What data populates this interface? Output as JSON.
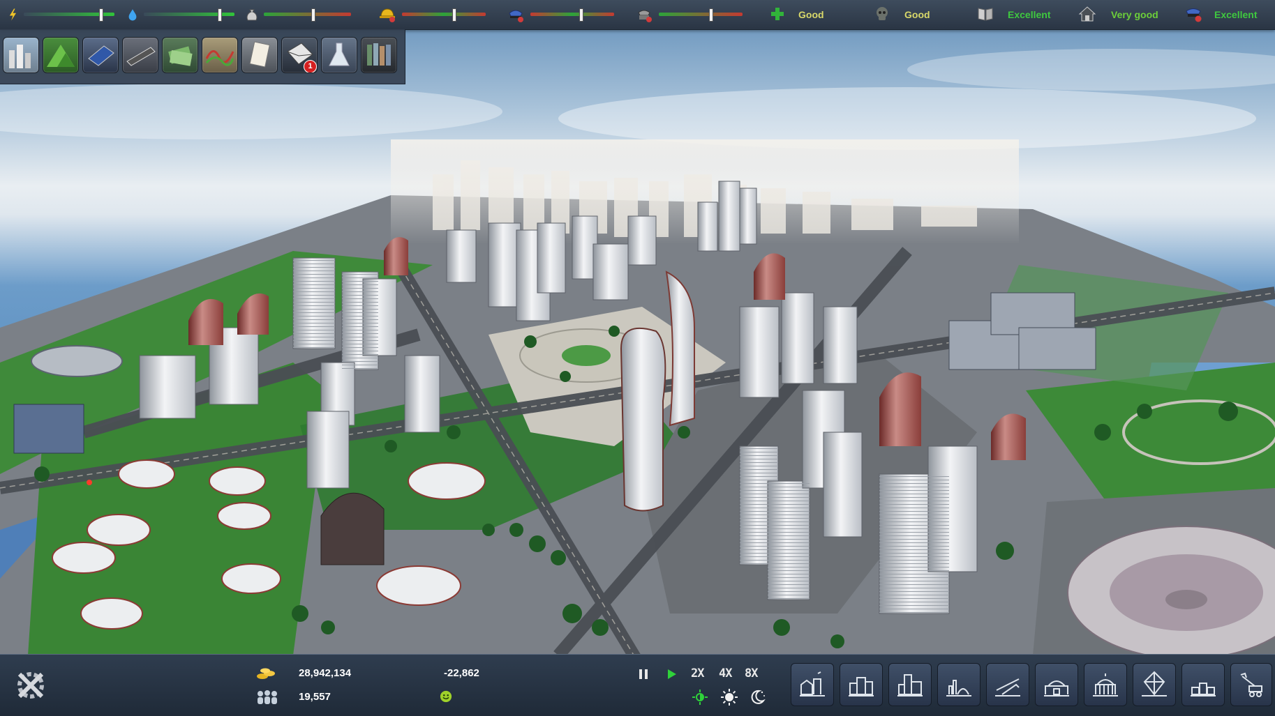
{
  "top_bar": {
    "meters": [
      {
        "name": "power",
        "icon": "lightning-icon",
        "level": 0.72
      },
      {
        "name": "water",
        "icon": "water-drop-icon",
        "level": 0.62
      },
      {
        "name": "waste",
        "icon": "trash-bag-icon",
        "level": 0.55
      },
      {
        "name": "fire",
        "icon": "firefighter-helmet-icon",
        "level": 0.55
      },
      {
        "name": "police",
        "icon": "police-cap-icon",
        "level": 0.55
      },
      {
        "name": "crime",
        "icon": "criminal-mask-icon",
        "level": 0.55
      }
    ],
    "ratings": [
      {
        "icon": "health-cross-icon",
        "label": "Good",
        "color": "#d9d96a"
      },
      {
        "icon": "education-skull-icon",
        "label": "Good",
        "color": "#d9d96a"
      },
      {
        "icon": "library-book-icon",
        "label": "Excellent",
        "color": "#3fc93f"
      },
      {
        "icon": "housing-icon",
        "label": "Very good",
        "color": "#6ccf3a"
      },
      {
        "icon": "security-icon",
        "label": "Excellent",
        "color": "#3fc93f"
      }
    ]
  },
  "tool_panel": {
    "tools": [
      {
        "icon": "city-overview-icon"
      },
      {
        "icon": "terrain-icon"
      },
      {
        "icon": "solar-panel-icon"
      },
      {
        "icon": "roads-icon"
      },
      {
        "icon": "finance-icon"
      },
      {
        "icon": "statistics-graph-icon"
      },
      {
        "icon": "documents-icon"
      },
      {
        "icon": "messages-icon",
        "badge": "1"
      },
      {
        "icon": "research-flask-icon"
      },
      {
        "icon": "library-icon"
      }
    ]
  },
  "bottom_bar": {
    "money": "28,942,134",
    "balance": "-22,862",
    "population": "19,557",
    "speed_labels": {
      "x2": "2X",
      "x4": "4X",
      "x8": "8X"
    },
    "build_categories": [
      {
        "icon": "residential-build-icon"
      },
      {
        "icon": "commercial-build-icon"
      },
      {
        "icon": "industrial-build-icon"
      },
      {
        "icon": "utilities-build-icon"
      },
      {
        "icon": "transport-build-icon"
      },
      {
        "icon": "services-build-icon"
      },
      {
        "icon": "government-build-icon"
      },
      {
        "icon": "landmark-build-icon"
      },
      {
        "icon": "storage-build-icon"
      },
      {
        "icon": "demolish-bulldozer-icon"
      }
    ]
  }
}
